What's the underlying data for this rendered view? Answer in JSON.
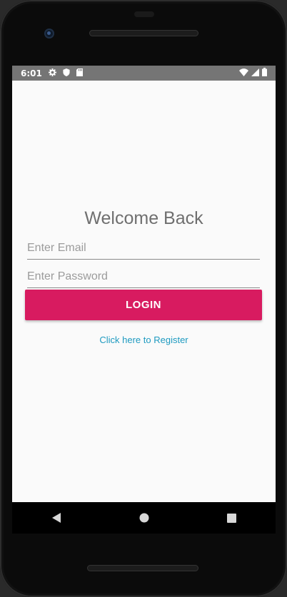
{
  "status_bar": {
    "time": "6:01",
    "icons": [
      "gear-icon",
      "shield-icon",
      "sd-card-icon",
      "wifi-icon",
      "signal-icon",
      "battery-icon"
    ]
  },
  "login": {
    "title": "Welcome Back",
    "email_placeholder": "Enter Email",
    "email_value": "",
    "password_placeholder": "Enter Password",
    "password_value": "",
    "login_button_label": "LOGIN",
    "register_link_text": "Click here to Register"
  },
  "nav_bar": {
    "buttons": [
      "back-icon",
      "home-icon",
      "recents-icon"
    ]
  },
  "colors": {
    "accent": "#d81b60",
    "link": "#1e9ac0",
    "status_bar": "#757575",
    "background": "#fafafa"
  }
}
